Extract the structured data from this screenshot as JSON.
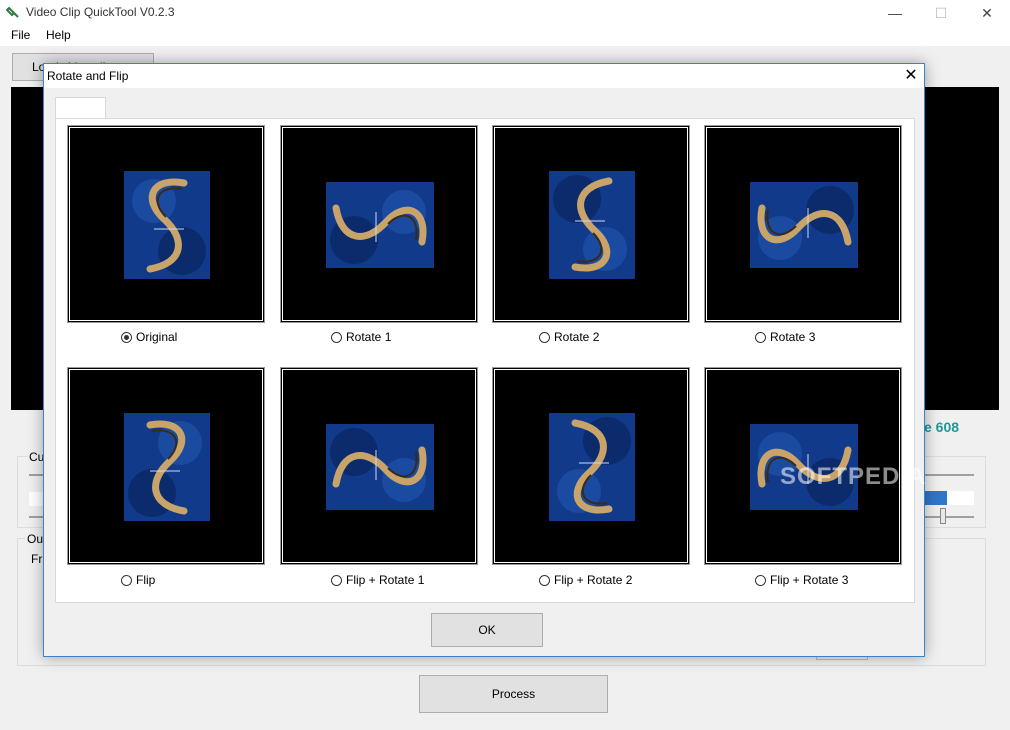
{
  "app": {
    "title": "Video Clip QuickTool V0.2.3",
    "controls": {
      "minimize": "—",
      "maximize": "☐",
      "close": "✕"
    }
  },
  "menu": {
    "items": [
      "File",
      "Help"
    ]
  },
  "main": {
    "load_button": "Load video clip",
    "frame_count": "e 608",
    "cut_group_label": "Cu",
    "output_group_label": "Out",
    "frames_label": "Fra",
    "process_button": "Process"
  },
  "dialog": {
    "title": "Rotate and Flip",
    "close": "✕",
    "tab_label": "",
    "ok_button": "OK",
    "options": [
      {
        "label": "Original",
        "checked": true
      },
      {
        "label": "Rotate 1",
        "checked": false
      },
      {
        "label": "Rotate 2",
        "checked": false
      },
      {
        "label": "Rotate 3",
        "checked": false
      },
      {
        "label": "Flip",
        "checked": false
      },
      {
        "label": "Flip + Rotate 1",
        "checked": false
      },
      {
        "label": "Flip + Rotate 2",
        "checked": false
      },
      {
        "label": "Flip + Rotate 3",
        "checked": false
      }
    ]
  },
  "watermark": "SOFTPEDIA",
  "colors": {
    "accent": "#3a84c6",
    "frame_count": "#1a9a9a",
    "progress": "#2e78c8",
    "art_blue": "#123a8a",
    "art_gold": "#c8a46a"
  }
}
